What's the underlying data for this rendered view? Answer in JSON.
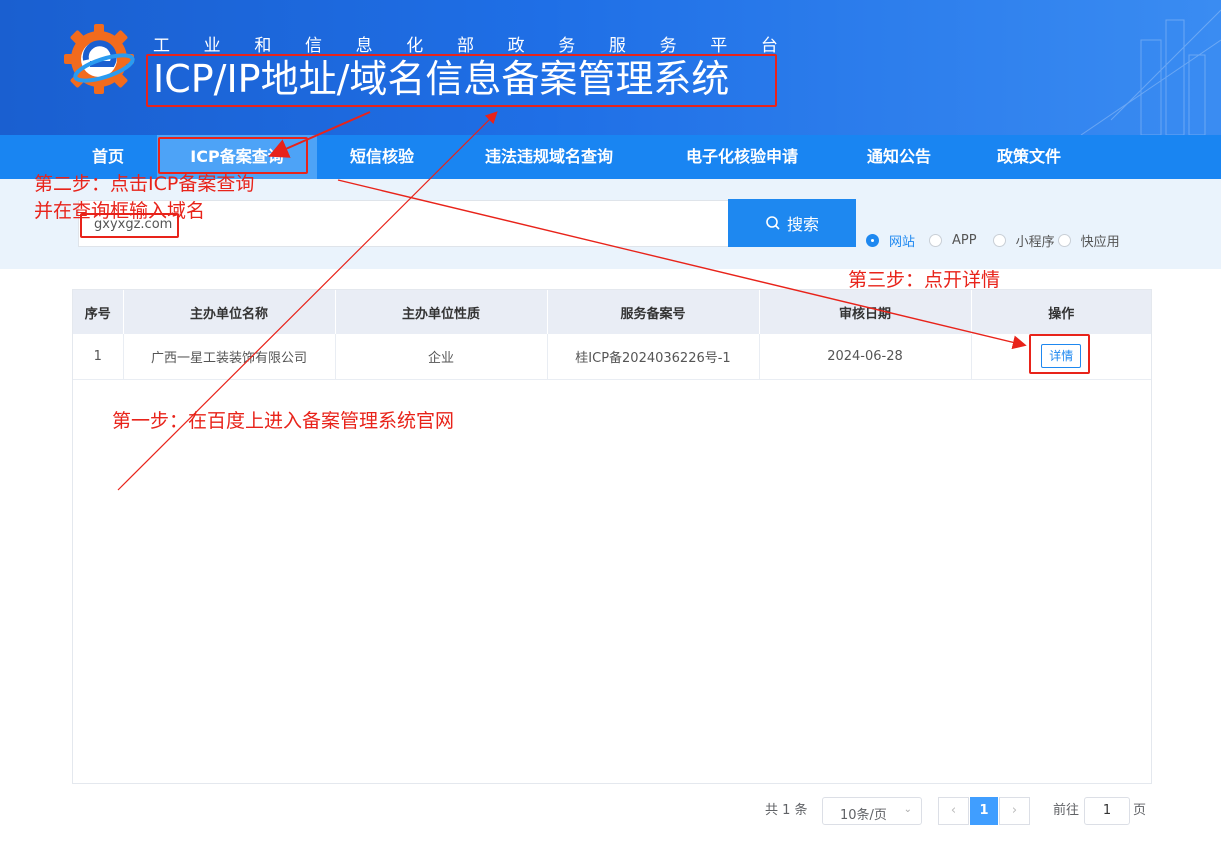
{
  "header": {
    "subtitle_chars": [
      "工",
      "业",
      "和",
      "信",
      "息",
      "化",
      "部",
      "政",
      "务",
      "服",
      "务",
      "平",
      "台"
    ],
    "title": "ICP/IP地址/域名信息备案管理系统"
  },
  "nav": {
    "items": [
      {
        "label": "首页"
      },
      {
        "label": "ICP备案查询",
        "active": true
      },
      {
        "label": "短信核验"
      },
      {
        "label": "违法违规域名查询"
      },
      {
        "label": "电子化核验申请"
      },
      {
        "label": "通知公告"
      },
      {
        "label": "政策文件"
      }
    ]
  },
  "search": {
    "value": "gxyxgz.com",
    "button_label": "搜索",
    "types": [
      {
        "label": "网站",
        "checked": true
      },
      {
        "label": "APP"
      },
      {
        "label": "小程序"
      },
      {
        "label": "快应用"
      }
    ]
  },
  "table": {
    "headers": [
      "序号",
      "主办单位名称",
      "主办单位性质",
      "服务备案号",
      "审核日期",
      "操作"
    ],
    "rows": [
      {
        "index": "1",
        "org": "广西一星工装装饰有限公司",
        "nature": "企业",
        "record_no": "桂ICP备2024036226号-1",
        "date": "2024-06-28",
        "action": "详情"
      }
    ]
  },
  "pagination": {
    "total": "共 1 条",
    "page_size": "10条/页",
    "current_page": "1",
    "goto_label": "前往",
    "goto_value": "1",
    "page_unit": "页"
  },
  "annotations": {
    "step1": "第一步：在百度上进入备案管理系统官网",
    "step2_line1": "第二步：点击ICP备案查询",
    "step2_line2": "并在查询框输入域名",
    "step3": "第三步：点开详情"
  },
  "colors": {
    "header_blue": "#1f6fe6",
    "nav_blue": "#1985f2",
    "accent": "#1e88f0",
    "annotation_red": "#e8231a"
  }
}
